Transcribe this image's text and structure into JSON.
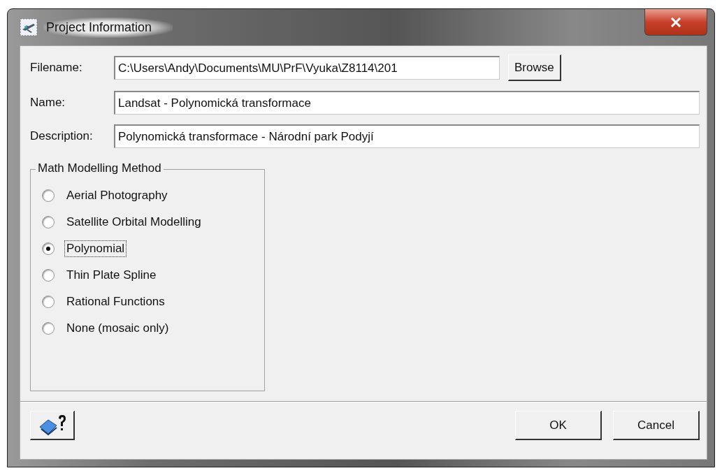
{
  "window": {
    "title": "Project Information"
  },
  "fields": [
    {
      "label": "Filename:",
      "value": "C:\\Users\\Andy\\Documents\\MU\\PrF\\Vyuka\\Z8114\\201",
      "button": "Browse"
    },
    {
      "label": "Name:",
      "value": "Landsat - Polynomická transformace"
    },
    {
      "label": "Description:",
      "value": "Polynomická transformace - Národní park Podyjí"
    }
  ],
  "method_group": {
    "title": "Math Modelling Method",
    "options": [
      {
        "label": "Aerial Photography",
        "selected": false
      },
      {
        "label": "Satellite Orbital Modelling",
        "selected": false
      },
      {
        "label": "Polynomial",
        "selected": true
      },
      {
        "label": "Thin Plate Spline",
        "selected": false
      },
      {
        "label": "Rational Functions",
        "selected": false
      },
      {
        "label": "None (mosaic only)",
        "selected": false
      }
    ]
  },
  "buttons": [
    "OK",
    "Cancel"
  ]
}
